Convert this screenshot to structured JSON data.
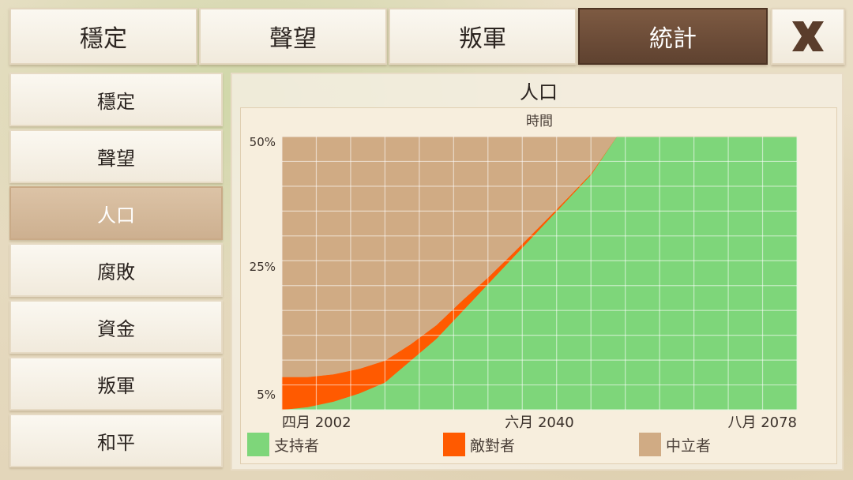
{
  "tabs": [
    {
      "label": "穩定",
      "active": false
    },
    {
      "label": "聲望",
      "active": false
    },
    {
      "label": "叛軍",
      "active": false
    },
    {
      "label": "統計",
      "active": true
    }
  ],
  "close_icon": "close-x-icon",
  "sidebar": {
    "items": [
      {
        "label": "穩定",
        "active": false
      },
      {
        "label": "聲望",
        "active": false
      },
      {
        "label": "人口",
        "active": true
      },
      {
        "label": "腐敗",
        "active": false
      },
      {
        "label": "資金",
        "active": false
      },
      {
        "label": "叛軍",
        "active": false
      },
      {
        "label": "和平",
        "active": false
      }
    ]
  },
  "panel": {
    "title": "人口"
  },
  "colors": {
    "supporters": "#7ed67a",
    "hostile": "#ff5a00",
    "neutral": "#d0ab84",
    "active_tab": "#6e4d38",
    "grid": "#ffffff"
  },
  "chart_data": {
    "type": "area",
    "title": "時間",
    "stacked": true,
    "x_tick_labels": [
      "四月 2002",
      "六月 2040",
      "八月 2078"
    ],
    "y_tick_labels": [
      "50%",
      "25%",
      "5%"
    ],
    "ylim": [
      0,
      50
    ],
    "grid": true,
    "legend_position": "bottom",
    "x": [
      0,
      1,
      2,
      3,
      4,
      5,
      6,
      7,
      8,
      9,
      10,
      11,
      12,
      13,
      14,
      15,
      16,
      17,
      18,
      19,
      20
    ],
    "series": [
      {
        "name": "支持者",
        "color": "#7ed67a",
        "values": [
          0,
          0.5,
          1.5,
          3,
          5,
          9,
          13,
          18,
          23,
          28,
          33,
          38,
          43,
          50,
          50,
          50,
          50,
          50,
          50,
          50,
          50
        ]
      },
      {
        "name": "敵對者",
        "color": "#ff5a00",
        "values": [
          6,
          5.5,
          5,
          4.5,
          4,
          3,
          2.5,
          2,
          1.2,
          0.8,
          0.5,
          0.3,
          0.2,
          0,
          0,
          0,
          0,
          0,
          0,
          0,
          0
        ]
      },
      {
        "name": "中立者",
        "color": "#d0ab84",
        "values": [
          44,
          44,
          43.5,
          42.5,
          41,
          38,
          34.5,
          30,
          25.8,
          21.2,
          16.5,
          11.7,
          6.8,
          0,
          0,
          0,
          0,
          0,
          0,
          0,
          0
        ]
      }
    ]
  }
}
